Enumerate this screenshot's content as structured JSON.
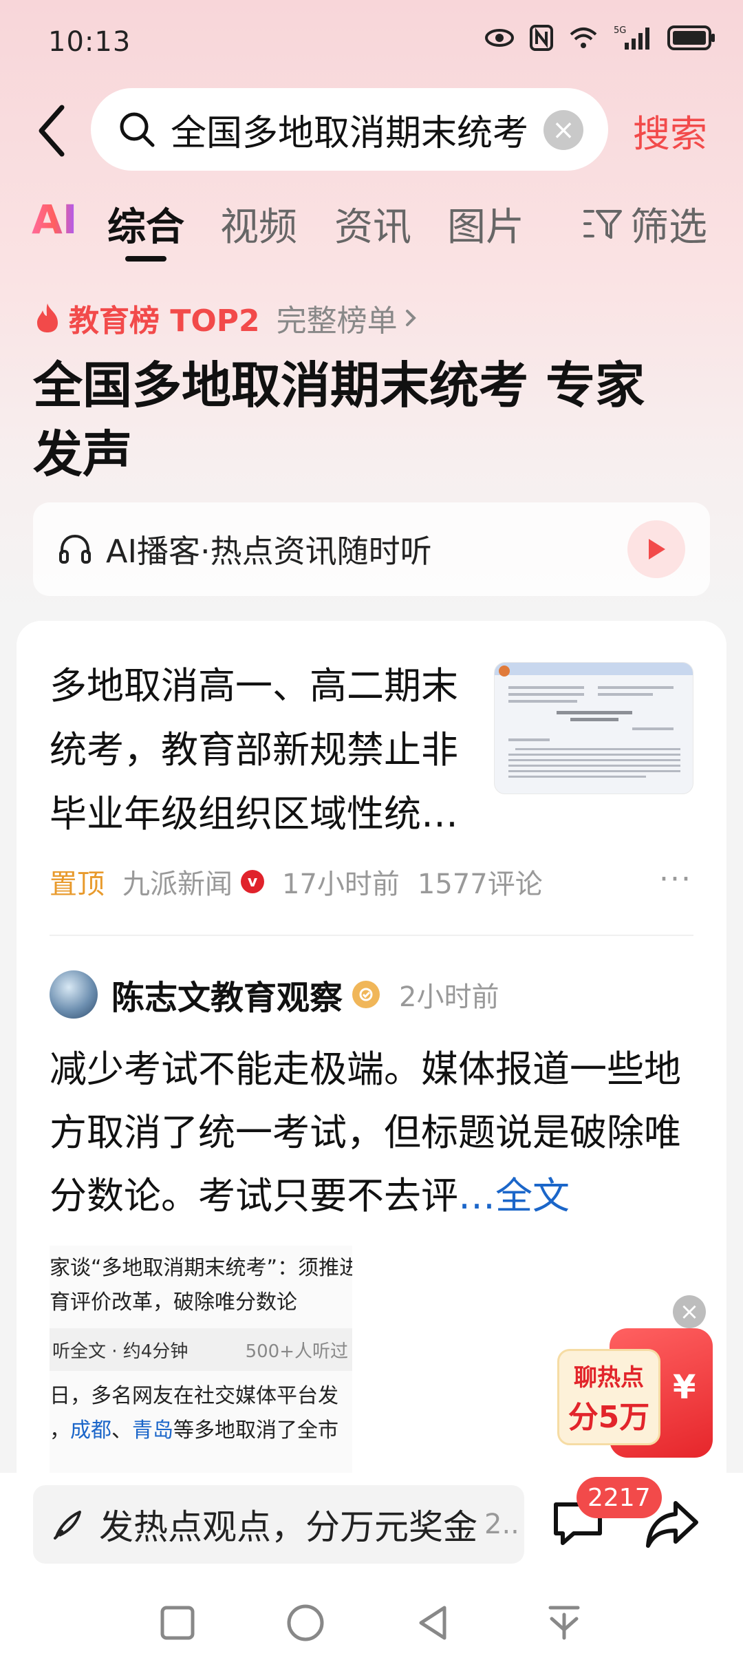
{
  "status_bar": {
    "time": "10:13",
    "network": "5G"
  },
  "search": {
    "query": "全国多地取消期末统考",
    "button_label": "搜索"
  },
  "tabs": [
    {
      "label": "AI"
    },
    {
      "label": "综合"
    },
    {
      "label": "视频"
    },
    {
      "label": "资讯"
    },
    {
      "label": "图片"
    },
    {
      "label": "筛选"
    }
  ],
  "hot_rank": {
    "label": "教育榜 TOP2",
    "link": "完整榜单"
  },
  "headline": "全国多地取消期末统考 专家发声",
  "podcast": {
    "label": "AI播客·热点资讯随时听"
  },
  "news_item": {
    "title": "多地取消高一、高二期末统考，教育部新规禁止非毕业年级组织区域性统…",
    "pin_label": "置顶",
    "source": "九派新闻",
    "time": "17小时前",
    "comments": "1577评论",
    "more": "···"
  },
  "post": {
    "author": "陈志文教育观察",
    "time": "2小时前",
    "body": "减少考试不能走极端。媒体报道一些地方取消了统一考试，但标题说是破除唯分数论。考试只要不去评",
    "full_text_link": "…全文",
    "image": {
      "line1": "家谈“多地取消期末统考”：须推进",
      "line2": "育评价改革，破除唯分数论",
      "listen_label": "听全文 · 约4分钟",
      "listen_count": "500+人听过",
      "line3": "日，多名网友在社交媒体平台发",
      "line4_pre": "，",
      "city1": "成都",
      "sep": "、",
      "city2": "青岛",
      "line4_post": "等多地取消了全市"
    }
  },
  "promo": {
    "line1": "聊热点",
    "line2": "分5万",
    "currency": "¥"
  },
  "bottom_bar": {
    "comment_placeholder": "发热点观点，分万元奖金",
    "comment_more": "2..",
    "comment_count": "2217"
  },
  "colors": {
    "accent": "#f24a4a",
    "link": "#1b66c9",
    "pin": "#e89a2c"
  }
}
